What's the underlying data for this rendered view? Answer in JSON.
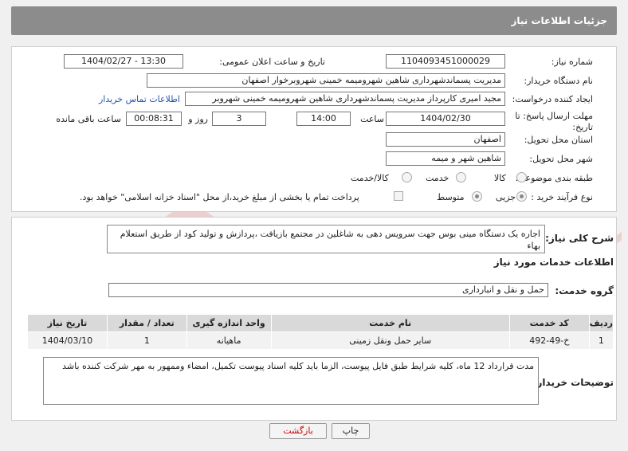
{
  "header": {
    "title": "جزئیات اطلاعات نیاز"
  },
  "form": {
    "need_number_label": "شماره نیاز:",
    "need_number": "1104093451000029",
    "announce_label": "تاریخ و ساعت اعلان عمومی:",
    "announce_value": "1404/02/27 - 13:30",
    "buyer_label": "نام دستگاه خریدار:",
    "buyer_value": "مدیریت پسماندشهرداری شاهین شهرومیمه خمینی شهروبرخوار اصفهان",
    "creator_label": "ایجاد کننده درخواست:",
    "creator_value": "مجید امیری کارپرداز مدیریت پسماندشهرداری شاهین شهرومیمه خمینی شهروبر",
    "contact_link": "اطلاعات تماس خریدار",
    "deadline_label_1": "مهلت ارسال پاسخ: تا",
    "deadline_label_2": "تاریخ:",
    "deadline_date": "1404/02/30",
    "time_label": "ساعت",
    "deadline_time": "14:00",
    "days_value": "3",
    "days_label": "روز و",
    "remaining_time": "00:08:31",
    "remaining_label": "ساعت باقی مانده",
    "province_label": "استان محل تحویل:",
    "province_value": "اصفهان",
    "city_label": "شهر محل تحویل:",
    "city_value": "شاهین شهر و میمه",
    "category_label": "طبقه بندی موضوعی:",
    "category_options": [
      "کالا",
      "خدمت",
      "کالا/خدمت"
    ],
    "process_label": "نوع فرآیند خرید :",
    "process_options": [
      "جزیی",
      "متوسط"
    ],
    "payment_note": "پرداخت تمام یا بخشی از مبلغ خرید،از محل \"اسناد خزانه اسلامی\" خواهد بود."
  },
  "description": {
    "label": "شرح کلی نیاز:",
    "text": "اجاره یک دستگاه مینی بوس جهت سرویس دهی به شاغلین در مجتمع  بازیافت ،پردازش و تولید کود  از طریق استعلام بهاء"
  },
  "services": {
    "title": "اطلاعات خدمات مورد نیاز",
    "group_label": "گروه خدمت:",
    "group_value": "حمل و نقل و انبارداری",
    "columns": [
      "ردیف",
      "کد خدمت",
      "نام خدمت",
      "واحد اندازه گیری",
      "تعداد / مقدار",
      "تاریخ نیاز"
    ],
    "rows": [
      [
        "1",
        "خ-49-492",
        "سایر حمل ونقل زمینی",
        "ماهیانه",
        "1",
        "1404/03/10"
      ]
    ]
  },
  "buyer_notes": {
    "label": "توضیحات خریدار:",
    "text": "مدت قرارداد 12 ماه، کلیه شرایط طبق فایل پیوست، الزما باید کلیه اسناد پیوست تکمیل، امضاء وممهور به مهر شرکت کننده باشد"
  },
  "buttons": {
    "print": "چاپ",
    "back": "بازگشت"
  },
  "watermark": {
    "text": "AriaTender.net",
    "color": "#d33"
  }
}
